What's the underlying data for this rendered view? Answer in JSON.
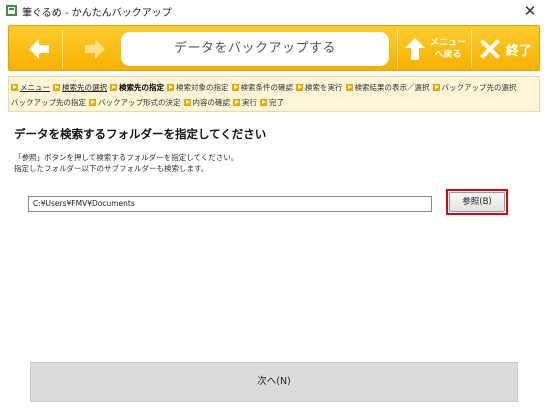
{
  "window": {
    "title": "筆ぐるめ - かんたんバックアップ",
    "close_glyph": "✕"
  },
  "toolbar": {
    "title": "データをバックアップする",
    "menu_label_line1": "メニュー",
    "menu_label_line2": "へ戻る",
    "end_label": "終了"
  },
  "breadcrumb": {
    "row1": [
      {
        "label": "メニュー",
        "state": "link"
      },
      {
        "label": "検索先の選択",
        "state": "link"
      },
      {
        "label": "検索先の指定",
        "state": "current"
      },
      {
        "label": "検索対象の指定",
        "state": "normal"
      },
      {
        "label": "検索条件の確認",
        "state": "normal"
      },
      {
        "label": "検索を実行",
        "state": "normal"
      },
      {
        "label": "検索結果の表示／選択",
        "state": "normal"
      },
      {
        "label": "バックアップ先の選択",
        "state": "normal"
      }
    ],
    "row2": [
      {
        "label": "バックアップ先の指定",
        "state": "normal"
      },
      {
        "label": "バックアップ形式の決定",
        "state": "normal"
      },
      {
        "label": "内容の確認",
        "state": "normal"
      },
      {
        "label": "実行",
        "state": "normal"
      },
      {
        "label": "完了",
        "state": "normal"
      }
    ]
  },
  "main": {
    "heading": "データを検索するフォルダーを指定してください",
    "desc_line1": "「参照」ボタンを押して検索するフォルダーを指定してください。",
    "desc_line2": "指定したフォルダー以下のサブフォルダーも検索します。",
    "path_value": "C:¥Users¥FMV¥Documents",
    "browse_label": "参照(B)",
    "next_label": "次へ(N)"
  },
  "colors": {
    "toolbar_yellow": "#f7b000",
    "breadcrumb_bg": "#fdf5d8",
    "highlight_red": "#e0000f"
  }
}
